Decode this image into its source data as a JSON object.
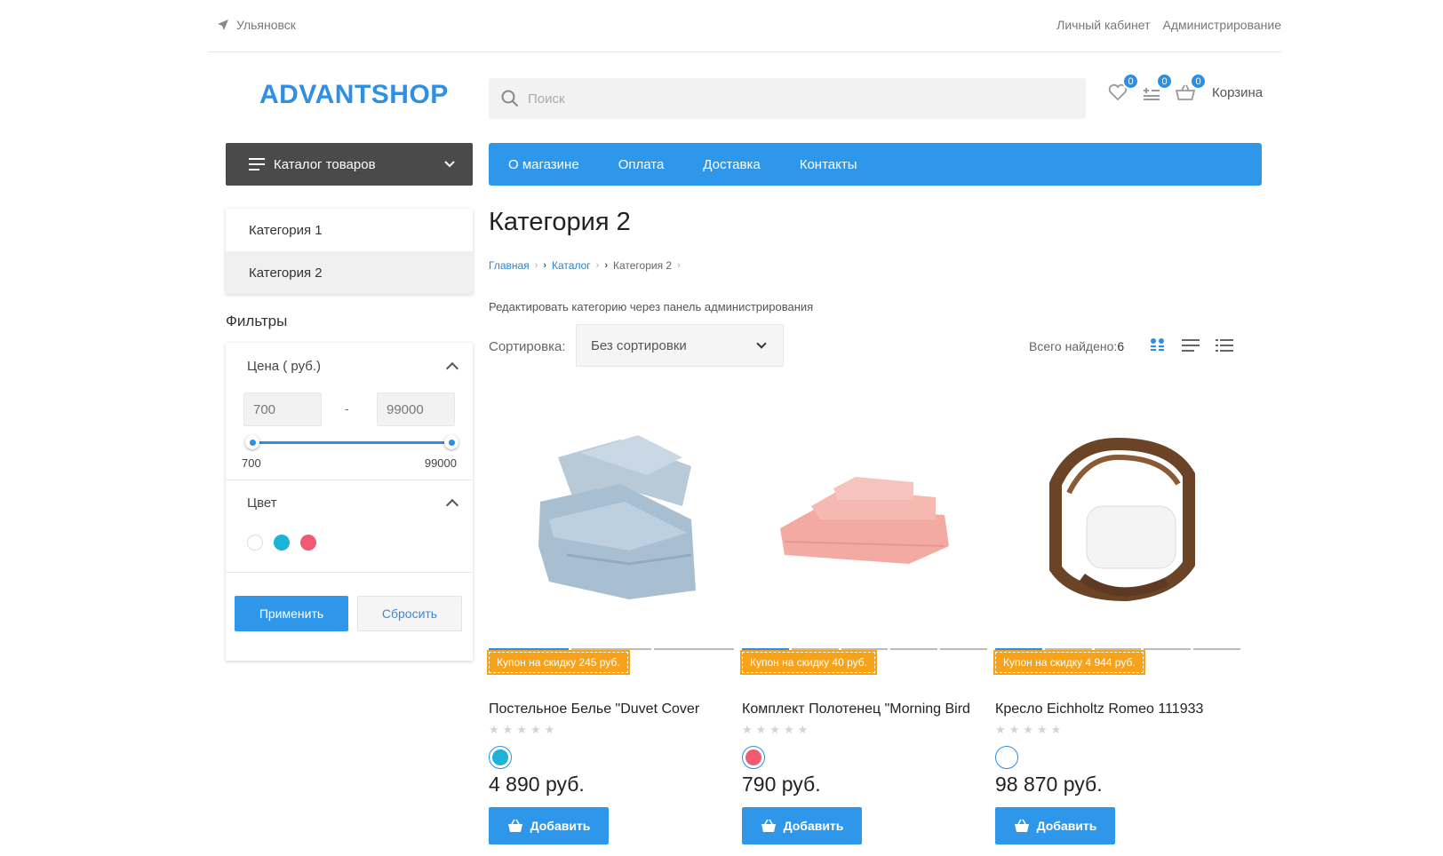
{
  "topbar": {
    "city": "Ульяновск",
    "links": [
      "Личный кабинет",
      "Администрирование"
    ]
  },
  "header": {
    "logo": "ADVANTSHOP",
    "search_placeholder": "Поиск",
    "wishlist_count": "0",
    "compare_count": "0",
    "cart_count": "0",
    "cart_label": "Корзина"
  },
  "catalog_menu": {
    "label": "Каталог товаров"
  },
  "nav": [
    "О магазине",
    "Оплата",
    "Доставка",
    "Контакты"
  ],
  "sidebar": {
    "categories": [
      {
        "label": "Категория 1",
        "active": false
      },
      {
        "label": "Категория 2",
        "active": true
      }
    ],
    "filters_title": "Фильтры",
    "price": {
      "title": "Цена ( руб.)",
      "from": "700",
      "to": "99000",
      "min_label": "700",
      "max_label": "99000",
      "dash": "-"
    },
    "color": {
      "title": "Цвет",
      "swatches": [
        "#ffffff",
        "#1cb3d9",
        "#f05a72"
      ]
    },
    "apply_label": "Применить",
    "reset_label": "Сбросить"
  },
  "main": {
    "title": "Категория 2",
    "breadcrumbs": [
      "Главная",
      "Каталог",
      "Категория 2"
    ],
    "edit_link": "Редактировать категорию через панель администрирования",
    "sort_label": "Сортировка:",
    "sort_value": "Без сортировки",
    "found_label": "Всего найдено:",
    "found_count": "6"
  },
  "products": [
    {
      "name": "Постельное Белье \"Duvet Cover",
      "coupon": "Купон на скидку 245 руб.",
      "stars": "★★★★★",
      "color": "#1cb3d9",
      "price": "4 890 руб.",
      "add_label": "Добавить",
      "image_icon": "bedding-image"
    },
    {
      "name": "Комплект Полотенец \"Morning Bird",
      "coupon": "Купон на скидку 40 руб.",
      "stars": "★★★★★",
      "color": "#f05a72",
      "price": "790 руб.",
      "add_label": "Добавить",
      "image_icon": "towels-image"
    },
    {
      "name": "Кресло Eichholtz Romeo 111933",
      "coupon": "Купон на скидку 4 944 руб.",
      "stars": "★★★★★",
      "color": "#ffffff",
      "price": "98 870 руб.",
      "add_label": "Добавить",
      "image_icon": "armchair-image"
    }
  ],
  "colors": {
    "accent": "#2f97ea",
    "coupon": "#f7a21b",
    "dark": "#4a4a4a"
  }
}
